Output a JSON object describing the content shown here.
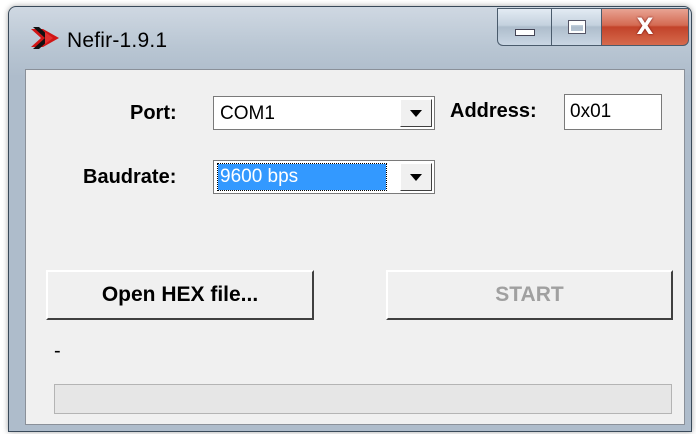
{
  "window": {
    "title": "Nefir-1.9.1",
    "close_glyph": "X"
  },
  "icons": {
    "app": "nefir-logo-icon",
    "minimize": "minimize-icon",
    "maximize": "maximize-icon",
    "close": "close-icon",
    "dropdown": "chevron-down-icon"
  },
  "form": {
    "port_label": "Port:",
    "port_value": "COM1",
    "address_label": "Address:",
    "address_value": "0x01",
    "baudrate_label": "Baudrate:",
    "baudrate_value": "9600 bps"
  },
  "buttons": {
    "open_hex": "Open HEX file...",
    "start": "START",
    "start_enabled": false
  },
  "status_text": "-",
  "progress": 0,
  "colors": {
    "selection": "#3399ff",
    "progress_fill": "#06b025",
    "disabled_text": "#a0a0a0"
  }
}
